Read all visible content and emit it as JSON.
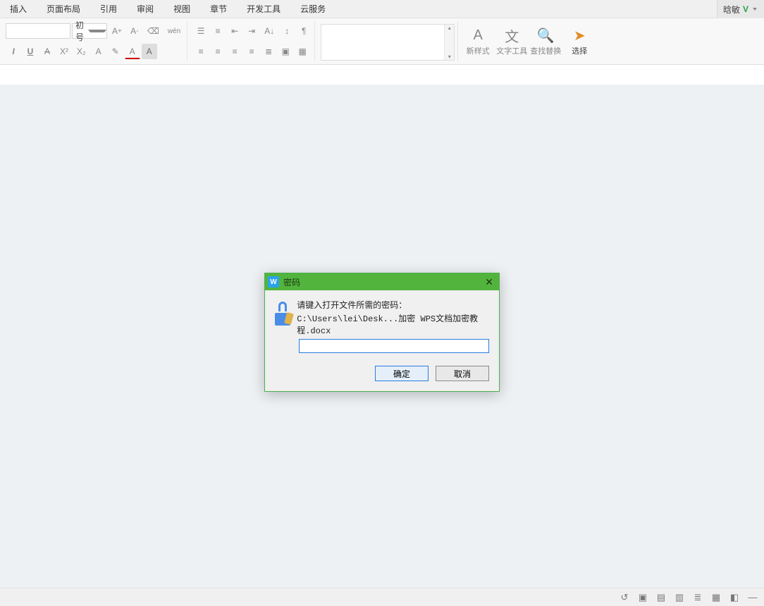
{
  "menu": {
    "items": [
      "插入",
      "页面布局",
      "引用",
      "审阅",
      "视图",
      "章节",
      "开发工具",
      "云服务"
    ]
  },
  "user": {
    "name": "晗敏",
    "badge": "V"
  },
  "ribbon": {
    "font_size": "初号",
    "big": [
      {
        "label": "新样式",
        "icon": "styles"
      },
      {
        "label": "文字工具",
        "icon": "text-tools"
      },
      {
        "label": "查找替换",
        "icon": "find-replace"
      },
      {
        "label": "选择",
        "icon": "select",
        "orange": true
      }
    ]
  },
  "dialog": {
    "title": "密码",
    "prompt": "请键入打开文件所需的密码：",
    "path": "C:\\Users\\lei\\Desk...加密 WPS文档加密教程.docx",
    "ok": "确定",
    "cancel": "取消"
  },
  "status": {
    "icons": [
      "history",
      "fullscreen",
      "reading",
      "page",
      "outline",
      "print",
      "focus",
      "minimize"
    ]
  }
}
